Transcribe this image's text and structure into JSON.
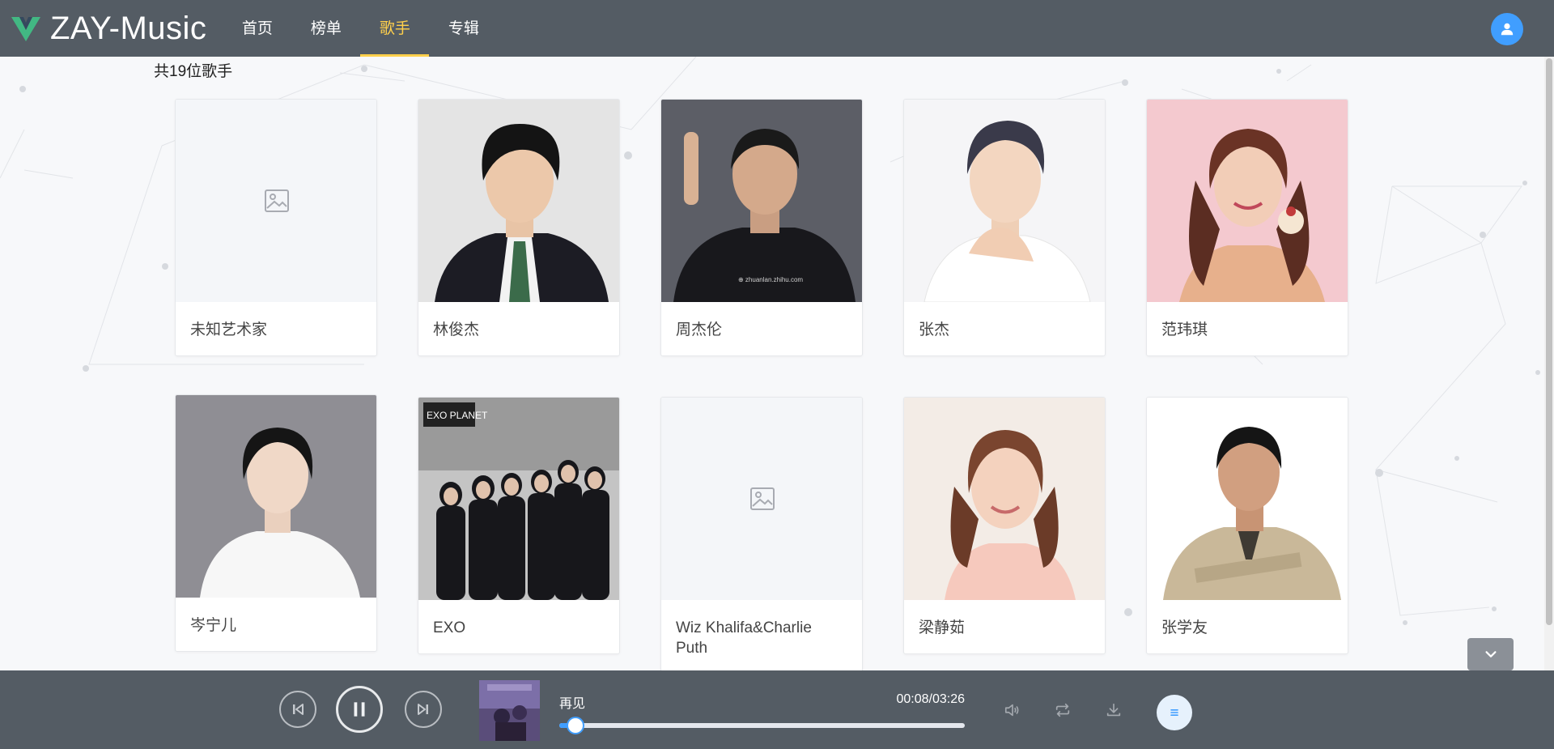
{
  "app": {
    "title": "ZAY-Music",
    "brand_color": "#42b883",
    "header_bg": "#545c64",
    "accent_active": "#ffd04b",
    "primary": "#409eff"
  },
  "nav": {
    "items": [
      {
        "label": "首页",
        "active": false
      },
      {
        "label": "榜单",
        "active": false
      },
      {
        "label": "歌手",
        "active": true
      },
      {
        "label": "专辑",
        "active": false
      }
    ],
    "user_icon": "user-icon"
  },
  "singers": {
    "count_text": "共19位歌手",
    "items": [
      {
        "name": "未知艺术家",
        "image": "placeholder"
      },
      {
        "name": "林俊杰",
        "image": "photo"
      },
      {
        "name": "周杰伦",
        "image": "photo"
      },
      {
        "name": "张杰",
        "image": "photo"
      },
      {
        "name": "范玮琪",
        "image": "photo"
      },
      {
        "name": "岑宁儿",
        "image": "photo"
      },
      {
        "name": "EXO",
        "image": "photo"
      },
      {
        "name": "Wiz Khalifa&Charlie Puth",
        "image": "placeholder"
      },
      {
        "name": "梁静茹",
        "image": "photo"
      },
      {
        "name": "张学友",
        "image": "photo"
      }
    ]
  },
  "player": {
    "song_title": "再见",
    "time": "00:08/03:26",
    "progress": 0.04,
    "state": "playing",
    "icons": [
      "prev-icon",
      "pause-icon",
      "next-icon",
      "volume-icon",
      "loop-icon",
      "download-icon",
      "playlist-icon"
    ]
  },
  "back_to_top_icon": "chevron-down-icon"
}
